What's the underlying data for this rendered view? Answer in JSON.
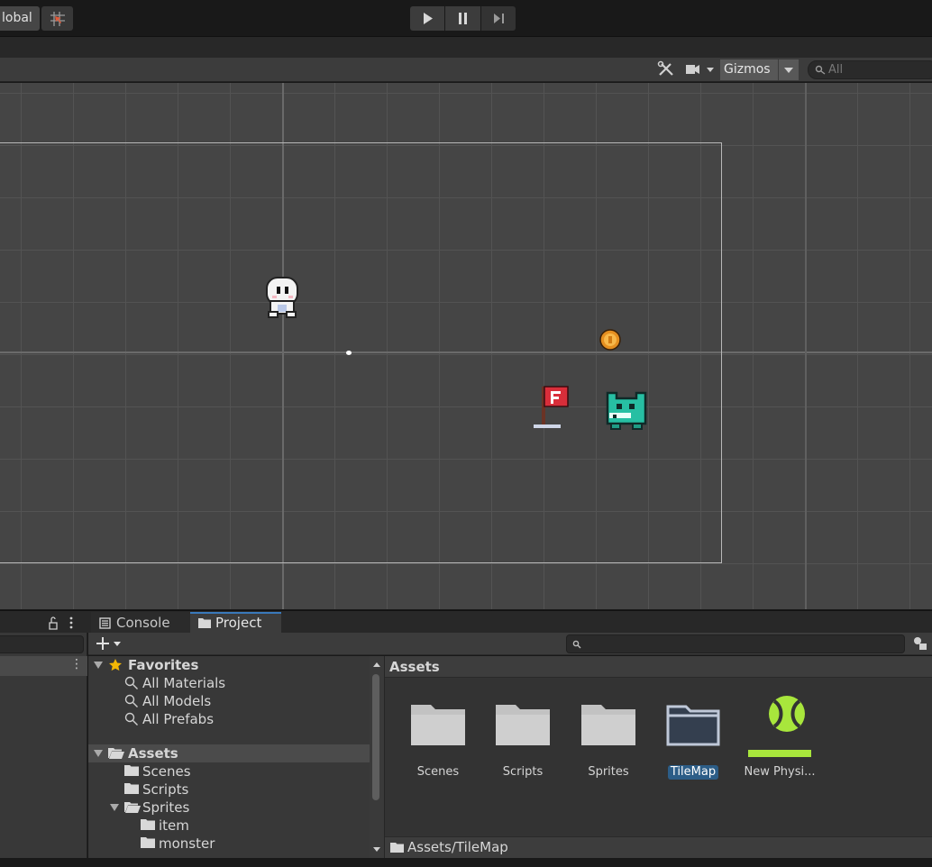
{
  "toolbar": {
    "global_label": "Global",
    "global_visible": "lobal"
  },
  "scene_header": {
    "gizmos_label": "Gizmos",
    "search_placeholder": "All"
  },
  "tabs": {
    "console": "Console",
    "project": "Project"
  },
  "project": {
    "tree": {
      "favorites": "Favorites",
      "fav_items": [
        "All Materials",
        "All Models",
        "All Prefabs"
      ],
      "assets": "Assets",
      "asset_items": [
        "Scenes",
        "Scripts",
        "Sprites"
      ],
      "sprite_items": [
        "item",
        "monster"
      ]
    },
    "grid_header": "Assets",
    "assets": [
      "Scenes",
      "Scripts",
      "Sprites",
      "TileMap",
      "New Physi..."
    ],
    "selected_asset": "TileMap",
    "footer_path": "Assets/TileMap"
  },
  "colors": {
    "accent": "#3a79bb",
    "selection": "#2c5d87",
    "physics_material": "#a8e63c",
    "favorite_star": "#f2b705"
  }
}
